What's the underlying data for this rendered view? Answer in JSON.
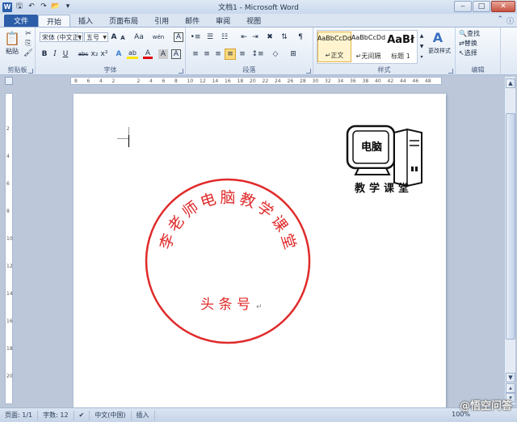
{
  "window": {
    "title": "文档1 - Microsoft Word",
    "qat": {
      "logo": "W",
      "save_icon": "save-icon",
      "undo_icon": "undo-icon",
      "redo_icon": "redo-icon",
      "folder_icon": "folder-icon"
    }
  },
  "tabs": [
    {
      "label": "文件"
    },
    {
      "label": "开始"
    },
    {
      "label": "插入"
    },
    {
      "label": "页面布局"
    },
    {
      "label": "引用"
    },
    {
      "label": "邮件"
    },
    {
      "label": "审阅"
    },
    {
      "label": "视图"
    }
  ],
  "ribbon": {
    "clipboard": {
      "label": "剪贴板",
      "paste": "粘贴"
    },
    "font": {
      "label": "字体",
      "font_name": "宋体 (中文正)",
      "font_size": "五号",
      "grow": "A",
      "shrink": "A",
      "case": "Aa",
      "wen": "wén",
      "a_box": "A",
      "bold": "B",
      "italic": "I",
      "underline": "U",
      "strike": "abc",
      "sub": "x₂",
      "sup": "x²",
      "text_effect": "A",
      "highlight": "ab",
      "font_color": "A",
      "char_shade": "A",
      "char_border": "A"
    },
    "paragraph": {
      "label": "段落"
    },
    "styles": {
      "label": "样式",
      "items": [
        {
          "sample": "AaBbCcDd",
          "name": "正文"
        },
        {
          "sample": "AaBbCcDd",
          "name": "无间隔"
        },
        {
          "sample": "AaBł",
          "name": "标题 1"
        }
      ],
      "change_styles": "更改样式"
    },
    "editing": {
      "label": "编辑",
      "find": "查找",
      "replace": "替换",
      "select": "选择"
    }
  },
  "document": {
    "stamp": {
      "chars": [
        "李",
        "老",
        "师",
        "电",
        "脑",
        "教",
        "学",
        "课",
        "堂"
      ],
      "bottom_text": "头 条 号",
      "color": "#e02a2a"
    },
    "logo": {
      "monitor_text": "电脑",
      "caption": "教学课堂"
    }
  },
  "status": {
    "page": "页面: 1/1",
    "words": "字数: 12",
    "language": "中文(中国)",
    "mode": "插入",
    "zoom": "100%",
    "watermark": "@悟空问答"
  },
  "ruler": {
    "h_ticks": [
      "8",
      "6",
      "4",
      "2",
      "",
      "2",
      "4",
      "6",
      "8",
      "10",
      "12",
      "14",
      "16",
      "18",
      "20",
      "22",
      "24",
      "26",
      "28",
      "30",
      "32",
      "34",
      "36",
      "38",
      "40",
      "42",
      "44",
      "46",
      "48"
    ],
    "v_ticks": [
      "2",
      "4",
      "6",
      "8",
      "10",
      "12",
      "14",
      "16",
      "18",
      "20"
    ]
  }
}
